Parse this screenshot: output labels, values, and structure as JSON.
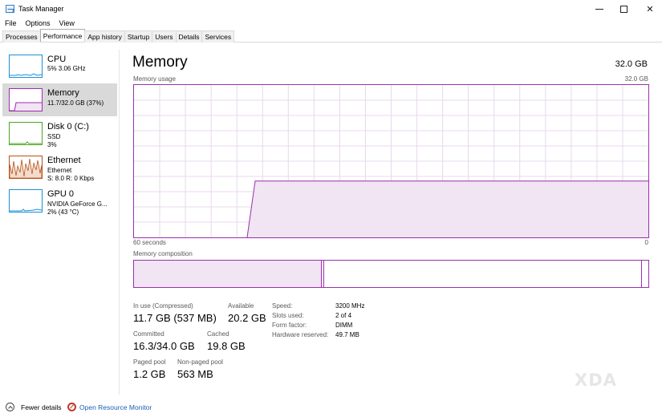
{
  "window": {
    "title": "Task Manager"
  },
  "menu": [
    "File",
    "Options",
    "View"
  ],
  "tabs": [
    "Processes",
    "Performance",
    "App history",
    "Startup",
    "Users",
    "Details",
    "Services"
  ],
  "sidebar": {
    "items": [
      {
        "name": "CPU",
        "sub1": "5% 3.06 GHz",
        "sub2": "",
        "sub3": "",
        "color": "#1d8fd6"
      },
      {
        "name": "Memory",
        "sub1": "11.7/32.0 GB (37%)",
        "sub2": "",
        "sub3": "",
        "color": "#9b2fae"
      },
      {
        "name": "Disk 0 (C:)",
        "sub1": "SSD",
        "sub2": "3%",
        "sub3": "",
        "color": "#4da622"
      },
      {
        "name": "Ethernet",
        "sub1": "Ethernet",
        "sub2": "S: 8.0  R: 0 Kbps",
        "sub3": "",
        "color": "#b5531a"
      },
      {
        "name": "GPU 0",
        "sub1": "NVIDIA GeForce G...",
        "sub2": "2% (43 °C)",
        "sub3": "",
        "color": "#1d8fd6"
      }
    ]
  },
  "main": {
    "title": "Memory",
    "total": "32.0 GB",
    "usage_label": "Memory usage",
    "usage_max": "32.0 GB",
    "time_label": "60 seconds",
    "time_end": "0",
    "composition_label": "Memory composition",
    "usage_level": 0.37
  },
  "stats": {
    "in_use_label": "In use (Compressed)",
    "in_use_value": "11.7 GB (537 MB)",
    "available_label": "Available",
    "available_value": "20.2 GB",
    "committed_label": "Committed",
    "committed_value": "16.3/34.0 GB",
    "cached_label": "Cached",
    "cached_value": "19.8 GB",
    "paged_label": "Paged pool",
    "paged_value": "1.2 GB",
    "nonpaged_label": "Non-paged pool",
    "nonpaged_value": "563 MB"
  },
  "hardware": {
    "speed_label": "Speed:",
    "speed_value": "3200 MHz",
    "slots_label": "Slots used:",
    "slots_value": "2 of 4",
    "form_label": "Form factor:",
    "form_value": "DIMM",
    "reserved_label": "Hardware reserved:",
    "reserved_value": "49.7 MB"
  },
  "footer": {
    "fewer_details": "Fewer details",
    "open_rm": "Open Resource Monitor"
  },
  "watermark": "XDA",
  "colors": {
    "memory": "#9b2fae",
    "memory_fill": "#f1e4f3",
    "grid": "#e8d8ec"
  }
}
